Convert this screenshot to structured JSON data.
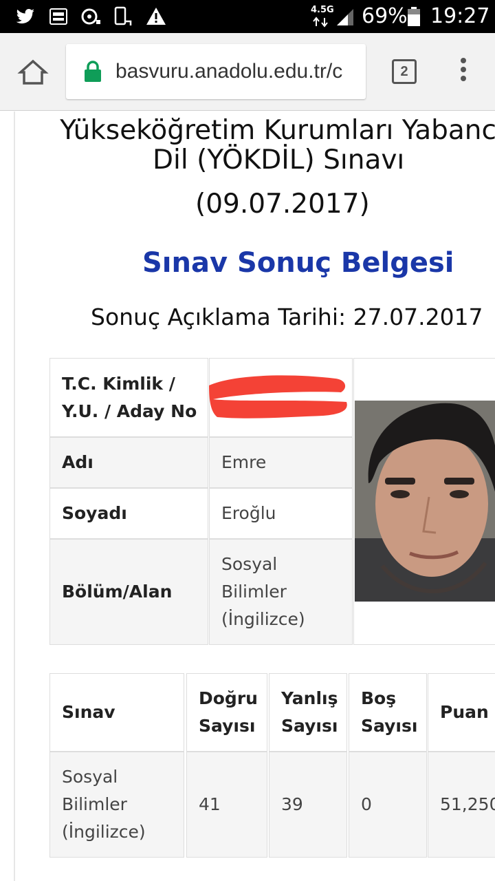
{
  "status_bar": {
    "icons": [
      "twitter-icon",
      "dsmart-sports-icon",
      "sync-icon",
      "phone-rotate-icon",
      "warning-icon"
    ],
    "network": "4.5G",
    "battery_percent": "69%",
    "time": "19:27"
  },
  "browser": {
    "url": "basvuru.anadolu.edu.tr/c",
    "tab_count": "2"
  },
  "header": {
    "title_line1": "Yükseköğretim Kurumları Yabancı",
    "title_line2": "Dil (YÖKDİL) Sınavı",
    "exam_date": "(09.07.2017)",
    "document_title": "Sınav Sonuç Belgesi",
    "result_date": "Sonuç Açıklama Tarihi: 27.07.2017"
  },
  "candidate": {
    "id_label_line1": "T.C. Kimlik /",
    "id_label_line2": "Y.U. / Aday No",
    "first_name_label": "Adı",
    "first_name": "Emre",
    "last_name_label": "Soyadı",
    "last_name": "Eroğlu",
    "field_label": "Bölüm/Alan",
    "field_line1": "Sosyal",
    "field_line2": "Bilimler",
    "field_line3": "(İngilizce)"
  },
  "results": {
    "headers": {
      "exam": "Sınav",
      "correct_line1": "Doğru",
      "correct_line2": "Sayısı",
      "wrong_line1": "Yanlış",
      "wrong_line2": "Sayısı",
      "empty_line1": "Boş",
      "empty_line2": "Sayısı",
      "score": "Puan"
    },
    "row": {
      "exam_line1": "Sosyal",
      "exam_line2": "Bilimler",
      "exam_line3": "(İngilizce)",
      "correct": "41",
      "wrong": "39",
      "empty": "0",
      "score": "51,250"
    }
  },
  "colors": {
    "accent_blue": "#1a37a8",
    "redaction_red": "#f44236",
    "lock_green": "#0f9d58"
  }
}
